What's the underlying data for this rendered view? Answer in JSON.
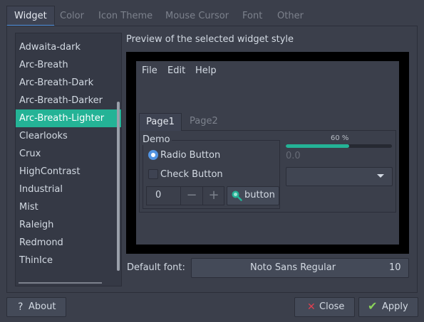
{
  "tabs": [
    "Widget",
    "Color",
    "Icon Theme",
    "Mouse Cursor",
    "Font",
    "Other"
  ],
  "active_tab": "Widget",
  "theme_list": {
    "items": [
      "Adwaita-dark",
      "Arc-Breath",
      "Arc-Breath-Dark",
      "Arc-Breath-Darker",
      "Arc-Breath-Lighter",
      "Clearlooks",
      "Crux",
      "HighContrast",
      "Industrial",
      "Mist",
      "Raleigh",
      "Redmond",
      "ThinIce"
    ],
    "selected": "Arc-Breath-Lighter"
  },
  "preview": {
    "title": "Preview of the selected widget style",
    "menu": [
      "File",
      "Edit",
      "Help"
    ],
    "tabs": [
      "Page1",
      "Page2"
    ],
    "group_label": "Demo",
    "radio_label": "Radio Button",
    "radio_checked": true,
    "check_label": "Check Button",
    "check_checked": false,
    "spin_value": "0",
    "spin_minus": "−",
    "spin_plus": "+",
    "button_label": "button",
    "button_icon": "search-icon",
    "progress_text": "60 %",
    "progress_value": 0.6,
    "slider_value_text": "0.0",
    "combo_value": ""
  },
  "font": {
    "label": "Default font:",
    "name": "Noto Sans Regular",
    "size": "10"
  },
  "buttons": {
    "about": "About",
    "about_icon": "?",
    "close": "Close",
    "close_icon": "✕",
    "apply": "Apply",
    "apply_icon": "✔"
  },
  "colors": {
    "accent": "#24b396",
    "selection_blue": "#5294e2",
    "close_red": "#e04050",
    "apply_green": "#8ad35a"
  }
}
